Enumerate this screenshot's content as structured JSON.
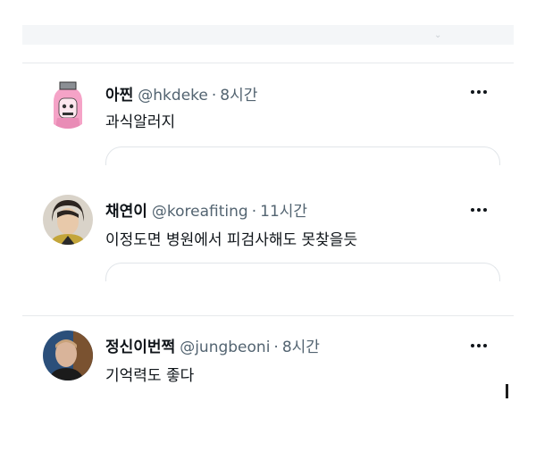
{
  "tweets": [
    {
      "name": "아찐",
      "handle": "@hkdeke",
      "separator": "·",
      "time": "8시간",
      "text": "과식알러지"
    },
    {
      "name": "채연이",
      "handle": "@koreafiting",
      "separator": "·",
      "time": "11시간",
      "text": "이정도면 병원에서 피검사해도 못찾을듯"
    },
    {
      "name": "정신이번쩍",
      "handle": "@jungbeoni",
      "separator": "·",
      "time": "8시간",
      "text": "기억력도 좋다"
    }
  ],
  "icons": {
    "more": "more-horizontal-icon",
    "avatar": "avatar-image"
  },
  "colors": {
    "text": "#0f1419",
    "muted": "#536471",
    "divider": "#e6e9ec"
  }
}
